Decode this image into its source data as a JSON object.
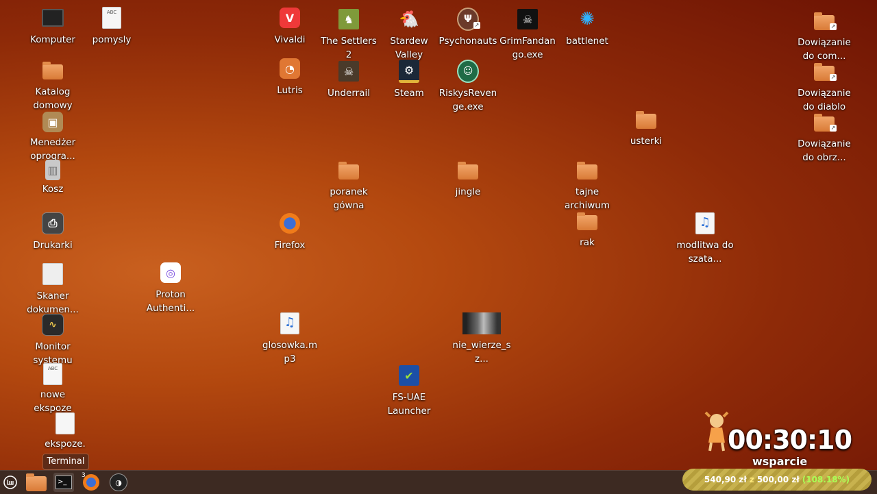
{
  "desktop_icons": {
    "komputer": "Komputer",
    "pomysly": "pomysly",
    "vivaldi": "Vivaldi",
    "settlers": "The Settlers 2",
    "stardew": "Stardew Valley",
    "psychonauts": "Psychonauts",
    "grimfandango": "GrimFandango.exe",
    "battlenet": "battlenet",
    "link_com": "Dowiązanie do com...",
    "katalog": "Katalog domowy",
    "lutris": "Lutris",
    "underrail": "Underrail",
    "steam": "Steam",
    "riskys": "RiskysRevenge.exe",
    "link_diablo": "Dowiązanie do diablo",
    "menedzer": "Menedżer oprogra...",
    "usterki": "usterki",
    "link_obrz": "Dowiązanie do obrz...",
    "kosz": "Kosz",
    "poranek": "poranek gówna",
    "jingle": "jingle",
    "tajne": "tajne archiwum",
    "drukarki": "Drukarki",
    "firefox": "Firefox",
    "rak": "rak",
    "modlitwa": "modlitwa do szata...",
    "skaner": "Skaner dokumen...",
    "proton": "Proton Authenti...",
    "monitor": "Monitor systemu",
    "glosowka": "glosowka.mp3",
    "nie_wierze": "nie_wierze_sz...",
    "nowe": "nowe ekspoze",
    "fsuae": "FS-UAE Launcher",
    "ekspoze": "ekspoze."
  },
  "tooltip": "Terminal",
  "taskbar": {
    "firefox_window_count": "3"
  },
  "overlay": {
    "timer": "00:30:10",
    "support_label": "wsparcie",
    "raised": "540,90 zł",
    "of_word": "z",
    "goal": "500,00 zł",
    "percent": "(108.18%)"
  },
  "colors": {
    "accent_progress_text": "#aaff55",
    "panel_bg": "#3d2a22"
  }
}
